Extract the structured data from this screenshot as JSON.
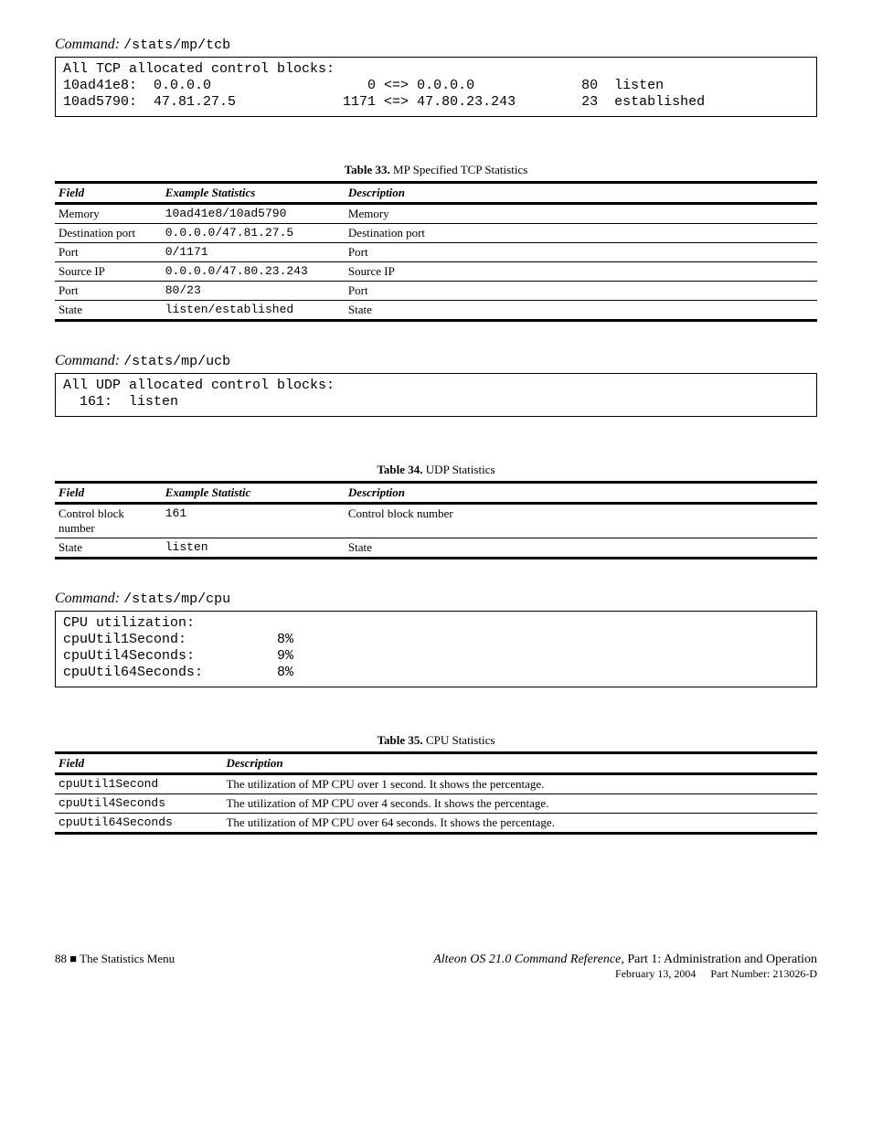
{
  "blocks": {
    "tcb": {
      "label": "Command:",
      "command": "/stats/mp/tcb",
      "pre": "All TCP allocated control blocks:\n10ad41e8:  0.0.0.0                   0 <=> 0.0.0.0             80  listen\n10ad5790:  47.81.27.5             1171 <=> 47.80.23.243        23  established"
    },
    "ucb": {
      "label": "Command:",
      "command": "/stats/mp/ucb",
      "pre": "All UDP allocated control blocks:\n  161:  listen"
    },
    "cpu": {
      "label": "Command:",
      "command": "/stats/mp/cpu",
      "pre": "CPU utilization:\ncpuUtil1Second:           8%\ncpuUtil4Seconds:          9%\ncpuUtil64Seconds:         8%"
    }
  },
  "tcb_table": {
    "caption_prefix": "Table 33.",
    "caption_text": "MP Specified TCP Statistics",
    "head_field": "Field",
    "head_example": "Example Statistics",
    "head_desc": "Description",
    "rows": [
      {
        "field": "Memory",
        "example": "10ad41e8/10ad5790",
        "desc": "Memory"
      },
      {
        "field": "Destination port",
        "example": "0.0.0.0/47.81.27.5",
        "desc": "Destination port"
      },
      {
        "field": "Port",
        "example": "0/1171",
        "desc": "Port"
      },
      {
        "field": "Source IP",
        "example": "0.0.0.0/47.80.23.243",
        "desc": "Source IP"
      },
      {
        "field": "Port",
        "example": "80/23",
        "desc": "Port"
      },
      {
        "field": "State",
        "example": "listen/established",
        "desc": "State"
      }
    ]
  },
  "ucb_table": {
    "caption_prefix": "Table 34.",
    "caption_text": "UDP Statistics",
    "head_field": "Field",
    "head_example": "Example Statistic",
    "head_desc": "Description",
    "rows": [
      {
        "field": "Control block number",
        "example": "161",
        "desc": "Control block number"
      },
      {
        "field": "State",
        "example": "listen",
        "desc": "State"
      }
    ]
  },
  "cpu_table": {
    "caption_prefix": "Table 35.",
    "caption_text": "CPU Statistics",
    "head_field": "Field",
    "head_desc": "Description",
    "rows": [
      {
        "field": "cpuUtil1Second",
        "desc": "The utilization of MP CPU over 1 second. It shows the percentage."
      },
      {
        "field": "cpuUtil4Seconds",
        "desc": "The utilization of MP CPU over 4 seconds. It shows the percentage."
      },
      {
        "field": "cpuUtil64Seconds",
        "desc": "The utilization of MP CPU over 64 seconds. It shows the percentage."
      }
    ]
  },
  "footer": {
    "left_page": "88",
    "left_sep": " ■ ",
    "left_text": "The Statistics Menu",
    "right_book": "Alteon OS 21.0 Command Reference",
    "right_suffix": ", Part 1: Administration and Operation",
    "date_label": "February 13, 2004",
    "pn_label": "Part Number: 213026-D"
  }
}
